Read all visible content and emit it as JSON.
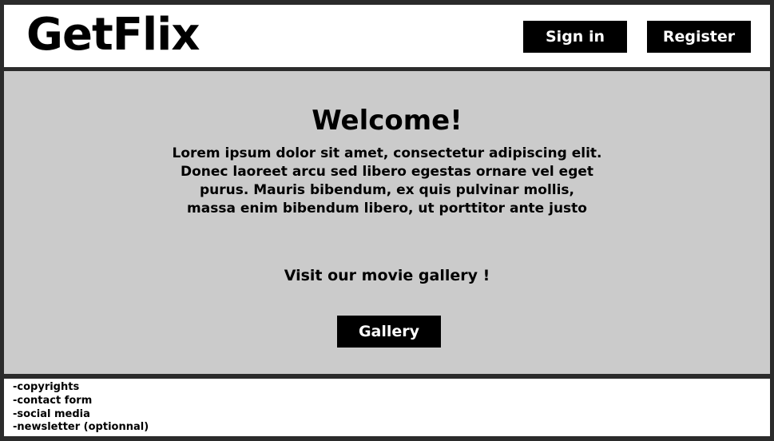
{
  "header": {
    "logo": "GetFlix",
    "sign_in_label": "Sign in",
    "register_label": "Register"
  },
  "main": {
    "title": "Welcome!",
    "body_lines": [
      "Lorem ipsum dolor sit amet, consectetur adipiscing elit.",
      "Donec laoreet arcu sed libero egestas ornare vel eget",
      "purus. Mauris bibendum, ex quis pulvinar mollis,",
      "massa enim bibendum libero, ut porttitor ante justo"
    ],
    "cta_text": "Visit our movie gallery !",
    "gallery_label": "Gallery"
  },
  "footer": {
    "items": [
      "-copyrights",
      "-contact form",
      "-social media",
      "-newsletter (optionnal)"
    ]
  },
  "colors": {
    "frame": "#2b2b2b",
    "header_bg": "#ffffff",
    "main_bg": "#cbcbcb",
    "button_bg": "#000000",
    "button_text": "#ffffff"
  }
}
